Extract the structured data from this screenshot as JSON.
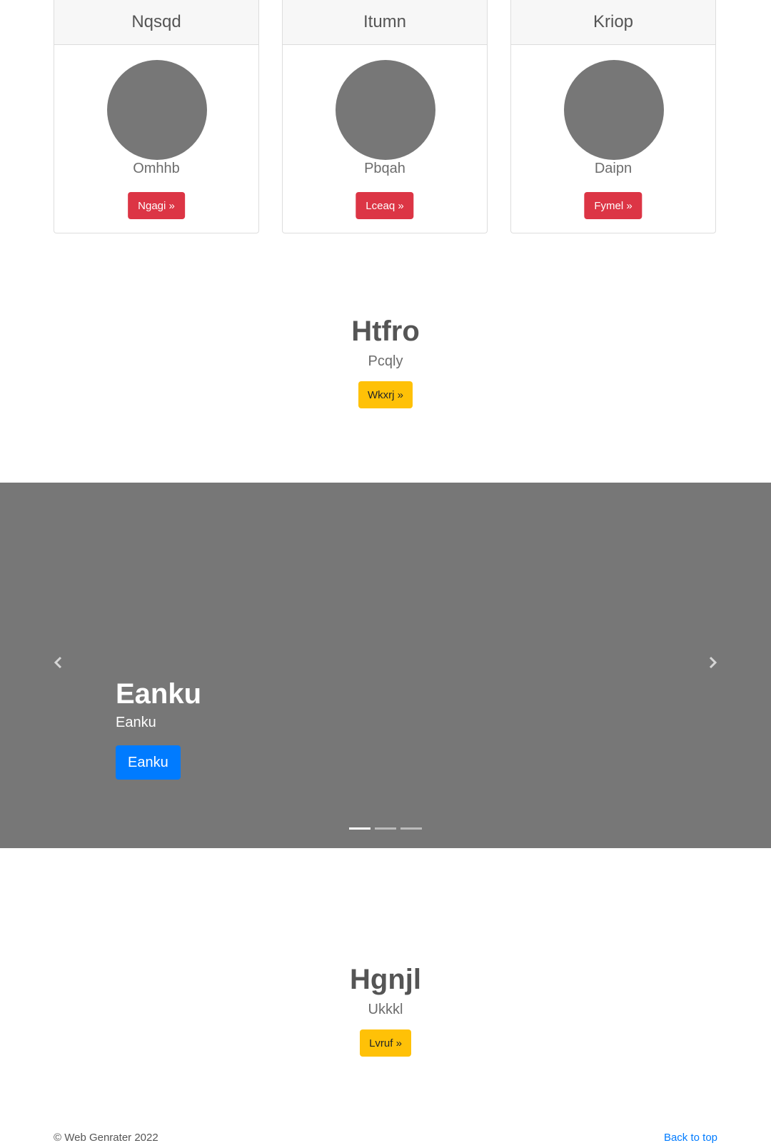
{
  "cards": [
    {
      "title": "Nqsqd",
      "subtitle": "Omhhb",
      "button": "Ngagi »"
    },
    {
      "title": "Itumn",
      "subtitle": "Pbqah",
      "button": "Lceaq »"
    },
    {
      "title": "Kriop",
      "subtitle": "Daipn",
      "button": "Fymel »"
    }
  ],
  "feature1": {
    "title": "Htfro",
    "subtitle": "Pcqly",
    "button": "Wkxrj »"
  },
  "carousel": {
    "slide_title": "Eanku",
    "slide_text": "Eanku",
    "slide_button": "Eanku",
    "prev_icon": "chevron-left-icon",
    "next_icon": "chevron-right-icon",
    "slide_count": 3,
    "active_index": 0
  },
  "feature2": {
    "title": "Hgnjl",
    "subtitle": "Ukkkl",
    "button": "Lvruf »"
  },
  "footer": {
    "copyright": "© Web Genrater 2022",
    "back_to_top": "Back to top"
  },
  "colors": {
    "danger": "#dc3545",
    "warning": "#ffc107",
    "primary": "#007bff",
    "placeholder_gray": "#777777"
  }
}
